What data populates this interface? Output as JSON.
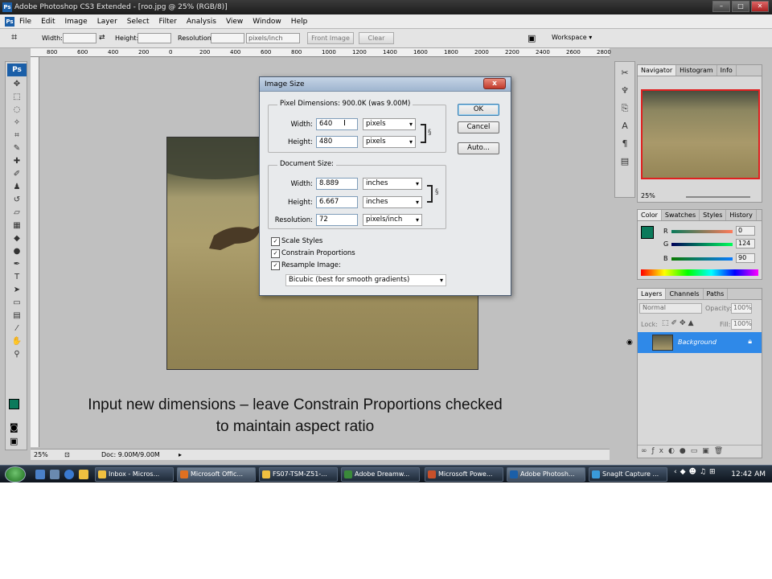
{
  "window": {
    "title": "Adobe Photoshop CS3 Extended - [roo.jpg @ 25% (RGB/8)]",
    "min": "–",
    "max": "□",
    "close": "✕"
  },
  "menu": [
    "File",
    "Edit",
    "Image",
    "Layer",
    "Select",
    "Filter",
    "Analysis",
    "View",
    "Window",
    "Help"
  ],
  "logo": "Ps",
  "options": {
    "width_label": "Width:",
    "height_label": "Height:",
    "resolution_label": "Resolution:",
    "units": "pixels/inch",
    "front_image": "Front Image",
    "clear": "Clear",
    "workspace": "Workspace ▾"
  },
  "ruler": [
    "800",
    "600",
    "400",
    "200",
    "0",
    "200",
    "400",
    "600",
    "800",
    "1000",
    "1200",
    "1400",
    "1600",
    "1800",
    "2000",
    "2200",
    "2400",
    "2600",
    "2800"
  ],
  "status": {
    "zoom": "25%",
    "doc": "Doc: 9.00M/9.00M"
  },
  "navigator": {
    "tabs": [
      "Navigator",
      "Histogram",
      "Info"
    ],
    "zoom": "25%"
  },
  "color_panel": {
    "tabs": [
      "Color",
      "Swatches",
      "Styles",
      "History"
    ],
    "r_label": "R",
    "g_label": "G",
    "b_label": "B",
    "r": "0",
    "g": "124",
    "b": "90",
    "fg_color": "#0b7a5b"
  },
  "layers": {
    "tabs": [
      "Layers",
      "Channels",
      "Paths"
    ],
    "blend": "Normal",
    "opacity_label": "Opacity:",
    "opacity": "100%",
    "lock_label": "Lock:",
    "fill_label": "Fill:",
    "fill": "100%",
    "layer_name": "Background"
  },
  "dialog": {
    "title": "Image Size",
    "close": "x",
    "pixel_dims_label": "Pixel Dimensions:  900.0K (was 9.00M)",
    "width_label": "Width:",
    "width_value": "640",
    "width_unit": "pixels",
    "height_label": "Height:",
    "height_value": "480",
    "height_unit": "pixels",
    "doc_size_label": "Document Size:",
    "doc_width_label": "Width:",
    "doc_width_value": "8.889",
    "doc_width_unit": "inches",
    "doc_height_label": "Height:",
    "doc_height_value": "6.667",
    "doc_height_unit": "inches",
    "resolution_label": "Resolution:",
    "resolution_value": "72",
    "resolution_unit": "pixels/inch",
    "scale_styles": "Scale Styles",
    "constrain": "Constrain Proportions",
    "resample": "Resample Image:",
    "resample_method": "Bicubic (best for smooth gradients)",
    "ok": "OK",
    "cancel": "Cancel",
    "auto": "Auto..."
  },
  "taskbar": {
    "items": [
      {
        "label": "Inbox - Micros...",
        "color": "#f0c040"
      },
      {
        "label": "Microsoft Offic...",
        "color": "#e07020"
      },
      {
        "label": "FS07-TSM-Z51-...",
        "color": "#f0c040"
      },
      {
        "label": "Adobe Dreamw...",
        "color": "#3a8a3a"
      },
      {
        "label": "Microsoft Powe...",
        "color": "#c8502a"
      },
      {
        "label": "Adobe Photosh...",
        "color": "#1b5fa8"
      },
      {
        "label": "SnagIt Capture ...",
        "color": "#3a9ad9"
      }
    ],
    "clock": "12:42 AM"
  },
  "caption": {
    "line1": "Input new dimensions – leave Constrain Proportions checked",
    "line2": "to maintain aspect ratio"
  }
}
